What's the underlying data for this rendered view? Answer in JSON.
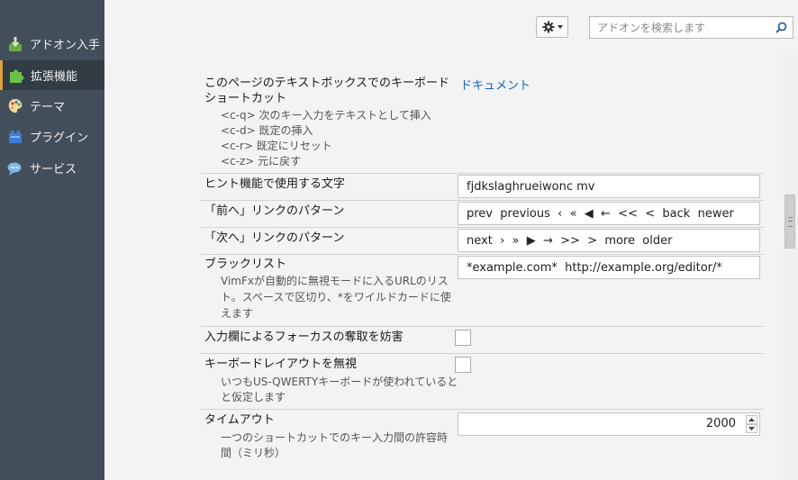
{
  "sidebar": {
    "items": [
      {
        "label": "アドオン入手",
        "icon": "download-addon-icon"
      },
      {
        "label": "拡張機能",
        "icon": "puzzle-piece-icon",
        "selected": true
      },
      {
        "label": "テーマ",
        "icon": "palette-icon"
      },
      {
        "label": "プラグイン",
        "icon": "plugin-block-icon"
      },
      {
        "label": "サービス",
        "icon": "chat-bubble-icon"
      }
    ]
  },
  "toolbar": {
    "gear_icon": "gear-icon",
    "search_placeholder": "アドオンを検索します",
    "search_icon": "search-icon"
  },
  "settings": {
    "keyboard_shortcuts": {
      "title_line1": "このページのテキストボックスでのキーボード",
      "title_line2": "ショートカット",
      "lines": [
        "<c-q> 次のキー入力をテキストとして挿入",
        "<c-d> 既定の挿入",
        "<c-r> 既定にリセット",
        "<c-z> 元に戻す"
      ],
      "link": "ドキュメント"
    },
    "hint_chars": {
      "title": "ヒント機能で使用する文字",
      "value": "fjdkslaghrueiwonc mv"
    },
    "prev_patterns": {
      "title": "「前へ」リンクのパターン",
      "value": "prev  previous  ‹  «  ◀  ←  <<  <  back  newer"
    },
    "next_patterns": {
      "title": "「次へ」リンクのパターン",
      "value": "next  ›  »  ▶  →  >>  >  more  older"
    },
    "blacklist": {
      "title": "ブラックリスト",
      "desc_lines": [
        "VimFxが自動的に無視モードに入るURLのリス",
        "ト。スペースで区切り、*をワイルドカードに使",
        "えます"
      ],
      "value": "*example.com*  http://example.org/editor/*"
    },
    "prevent_focus": {
      "title": "入力欄によるフォーカスの奪取を妨害",
      "checked": false
    },
    "ignore_layout": {
      "title": "キーボードレイアウトを無視",
      "desc_lines": [
        "いつもUS-QWERTYキーボードが使われていると",
        "と仮定します"
      ],
      "checked": false
    },
    "timeout": {
      "title": "タイムアウト",
      "desc_lines": [
        "一つのショートカットでのキー入力間の許容時",
        "間（ミリ秒）"
      ],
      "value": "2000"
    }
  },
  "colors": {
    "sidebar_bg": "#424f5a",
    "sidebar_selected_bg": "#323c45",
    "selected_accent": "#e0a040",
    "link": "#0f64c0"
  }
}
